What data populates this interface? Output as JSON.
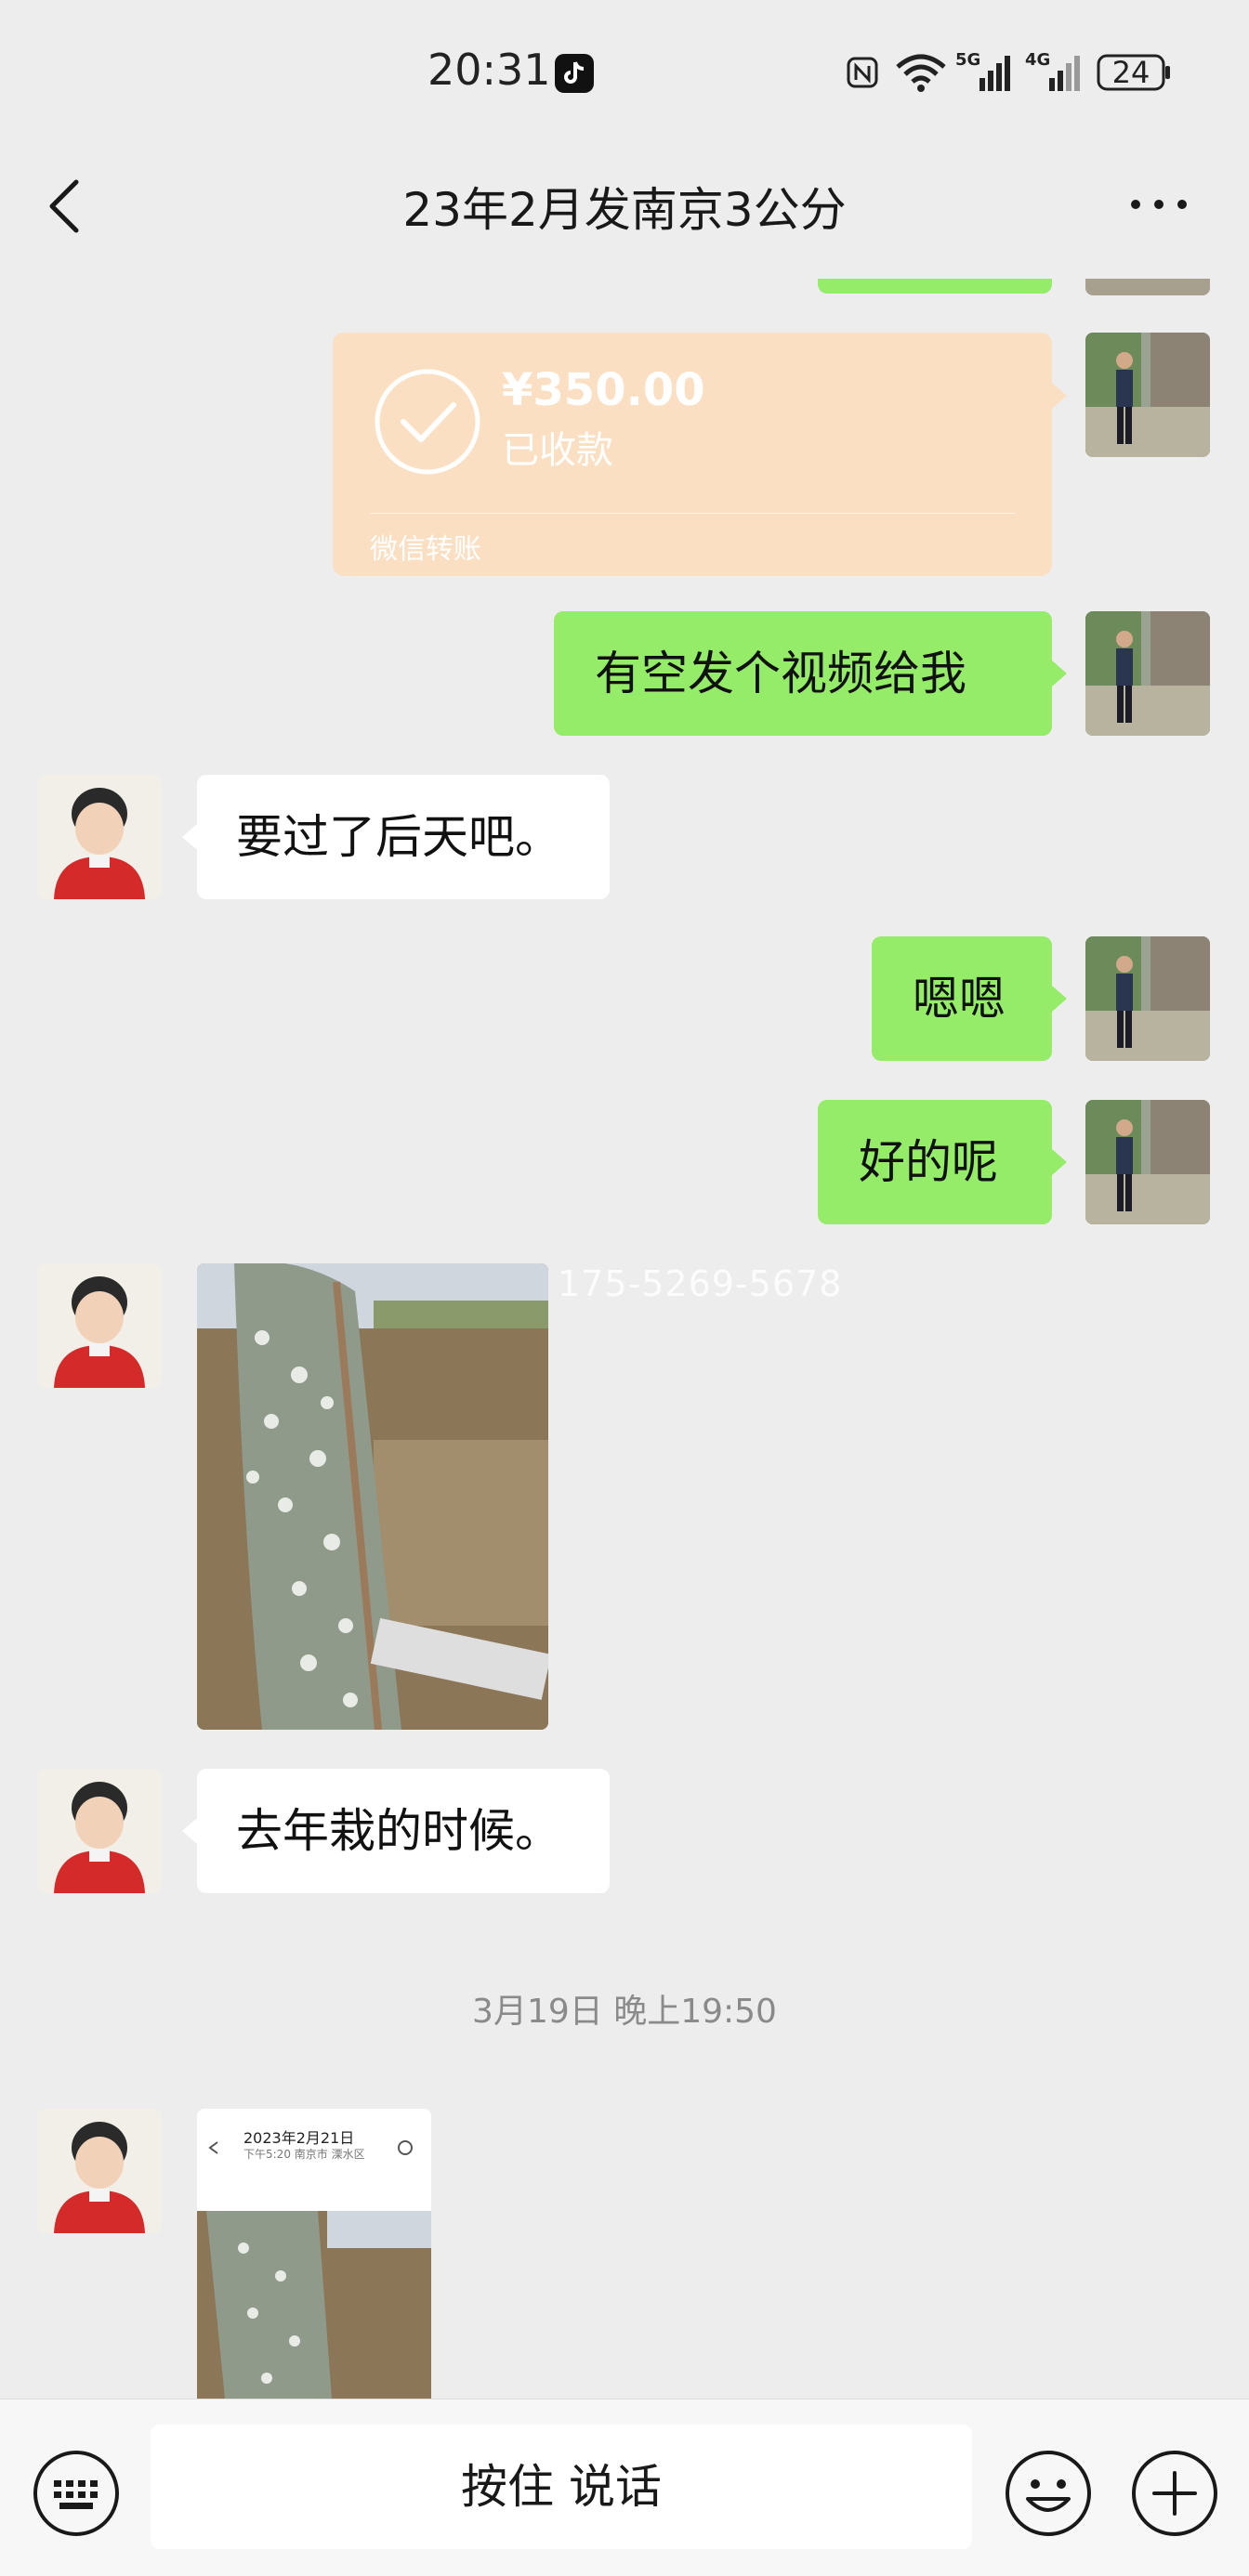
{
  "status_bar": {
    "time": "20:31",
    "battery": "24",
    "icons": [
      "tiktok-icon",
      "nfc-icon",
      "wifi-icon",
      "signal-5g-icon",
      "signal-4g-icon",
      "battery-icon"
    ]
  },
  "header": {
    "title": "23年2月发南京3公分",
    "back_icon": "chevron-left-icon",
    "more_icon": "more-dots-icon"
  },
  "messages": [
    {
      "side": "me",
      "type": "transfer",
      "amount": "¥350.00",
      "status": "已收款",
      "label": "微信转账"
    },
    {
      "side": "me",
      "type": "text",
      "text": "有空发个视频给我"
    },
    {
      "side": "other",
      "type": "text",
      "text": "要过了后天吧。"
    },
    {
      "side": "me",
      "type": "text",
      "text": "嗯嗯"
    },
    {
      "side": "me",
      "type": "text",
      "text": "好的呢"
    },
    {
      "side": "other",
      "type": "image",
      "watermark": "175-5269-5678"
    },
    {
      "side": "other",
      "type": "text",
      "text": "去年栽的时候。"
    },
    {
      "type": "timestamp",
      "text": "3月19日 晚上19:50"
    },
    {
      "side": "other",
      "type": "image",
      "caption_date": "2023年2月21日",
      "caption_sub": "下午5:20 南京市 溧水区"
    }
  ],
  "input_bar": {
    "hold_to_talk": "按住 说话",
    "icons": [
      "keyboard-icon",
      "emoji-icon",
      "plus-icon"
    ]
  },
  "colors": {
    "background": "#ededed",
    "my_bubble": "#95ec69",
    "other_bubble": "#ffffff",
    "transfer_card": "#fbdfc2"
  }
}
